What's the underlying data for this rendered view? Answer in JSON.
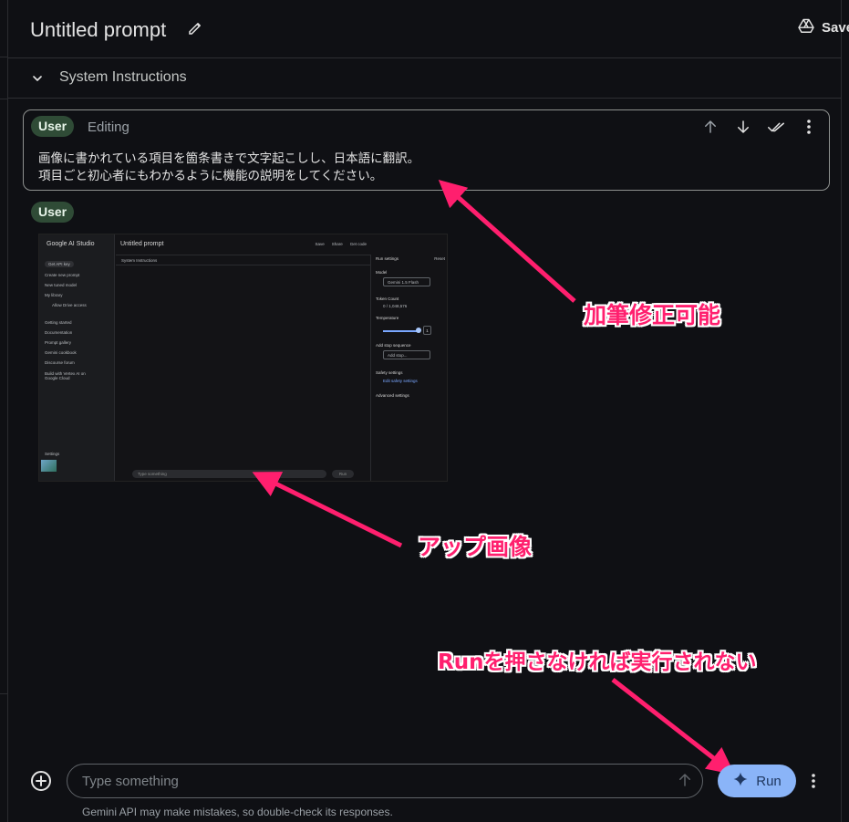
{
  "header": {
    "title": "Untitled prompt",
    "save_label": "Save"
  },
  "system_instructions": {
    "label": "System Instructions"
  },
  "turn1": {
    "role": "User",
    "status": "Editing",
    "text": "画像に書かれている項目を箇条書きで文字起こしし、日本語に翻訳。\n項目ごと初心者にもわかるように機能の説明をしてください。"
  },
  "turn2": {
    "role": "User"
  },
  "screenshot": {
    "brand": "Google AI Studio",
    "get_api_key": "Get API key",
    "sidebar": [
      "Create new prompt",
      "New tuned model",
      "My library",
      "Allow Drive access",
      "Getting started",
      "Documentation",
      "Prompt gallery",
      "Gemini cookbook",
      "Discourse forum",
      "Build with Vertex AI on Google Cloud",
      "Settings"
    ],
    "title": "Untitled prompt",
    "toolbar": [
      "Save",
      "Share",
      "Get code"
    ],
    "system_instructions": "System Instructions",
    "input_placeholder": "Type something",
    "run": "Run",
    "run_settings": "Run settings",
    "reset": "Reset",
    "model_label": "Model",
    "model_value": "Gemini 1.5 Flash",
    "token_count_label": "Token Count",
    "token_count_value": "0 / 1,048,576",
    "temperature_label": "Temperature",
    "temperature_value": "1",
    "stop_sequence_label": "Add stop sequence",
    "stop_placeholder": "Add stop...",
    "safety_label": "Safety settings",
    "safety_link": "Edit safety settings",
    "advanced_label": "Advanced settings"
  },
  "annotations": {
    "editable": "加筆修正可能",
    "app_image": "アップ画像",
    "run_note": "Runを押さなければ実行されない",
    "color": "#ff1f6e"
  },
  "input": {
    "placeholder": "Type something",
    "run_label": "Run",
    "disclaimer": "Gemini API may make mistakes, so double-check its responses."
  },
  "colors": {
    "background": "#0f1014",
    "badge": "#2f4b36",
    "run_button": "#8ab4f8"
  }
}
